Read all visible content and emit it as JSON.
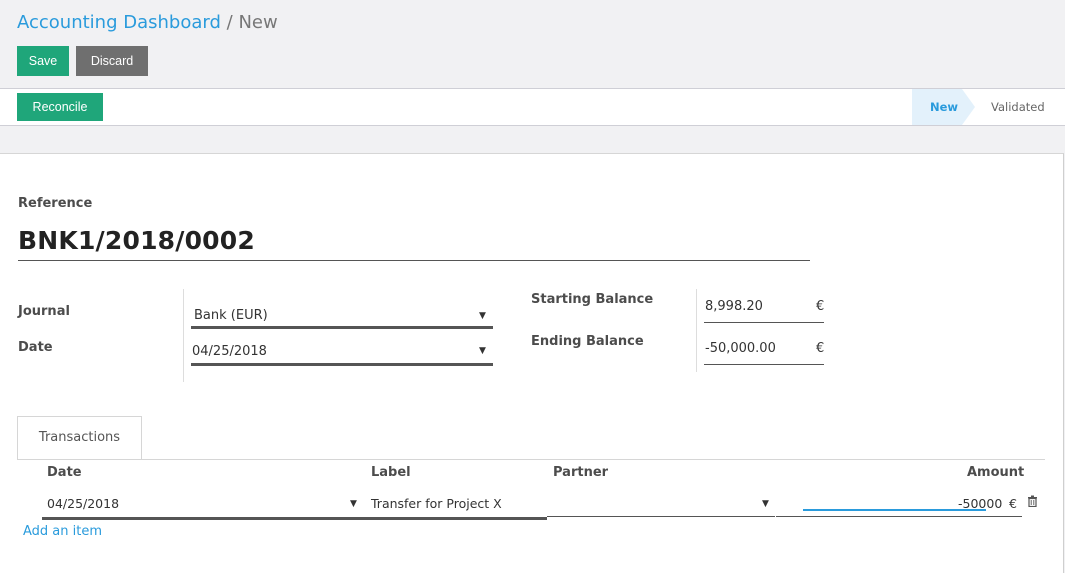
{
  "breadcrumb": {
    "parent": "Accounting Dashboard",
    "separator": "/",
    "current": "New"
  },
  "toolbar": {
    "save_label": "Save",
    "discard_label": "Discard"
  },
  "header": {
    "reconcile_label": "Reconcile",
    "statuses": [
      "New",
      "Validated"
    ]
  },
  "form": {
    "reference_label": "Reference",
    "reference_value": "BNK1/2018/0002",
    "journal_label": "Journal",
    "journal_value": "Bank (EUR)",
    "date_label": "Date",
    "date_value": "04/25/2018",
    "starting_balance_label": "Starting Balance",
    "starting_balance_value": "8,998.20",
    "ending_balance_label": "Ending Balance",
    "ending_balance_value": "-50,000.00",
    "currency": "€"
  },
  "tabs": [
    "Transactions"
  ],
  "transactions": {
    "columns": [
      "Date",
      "Label",
      "Partner",
      "Amount"
    ],
    "row": {
      "date": "04/25/2018",
      "label": "Transfer for Project X",
      "partner": "",
      "amount": "-50000",
      "currency": "€"
    },
    "add_item_label": "Add an item"
  },
  "colors": {
    "primary": "#1fa67a",
    "link": "#2a9bdc",
    "secondary": "#6f6f6f"
  }
}
